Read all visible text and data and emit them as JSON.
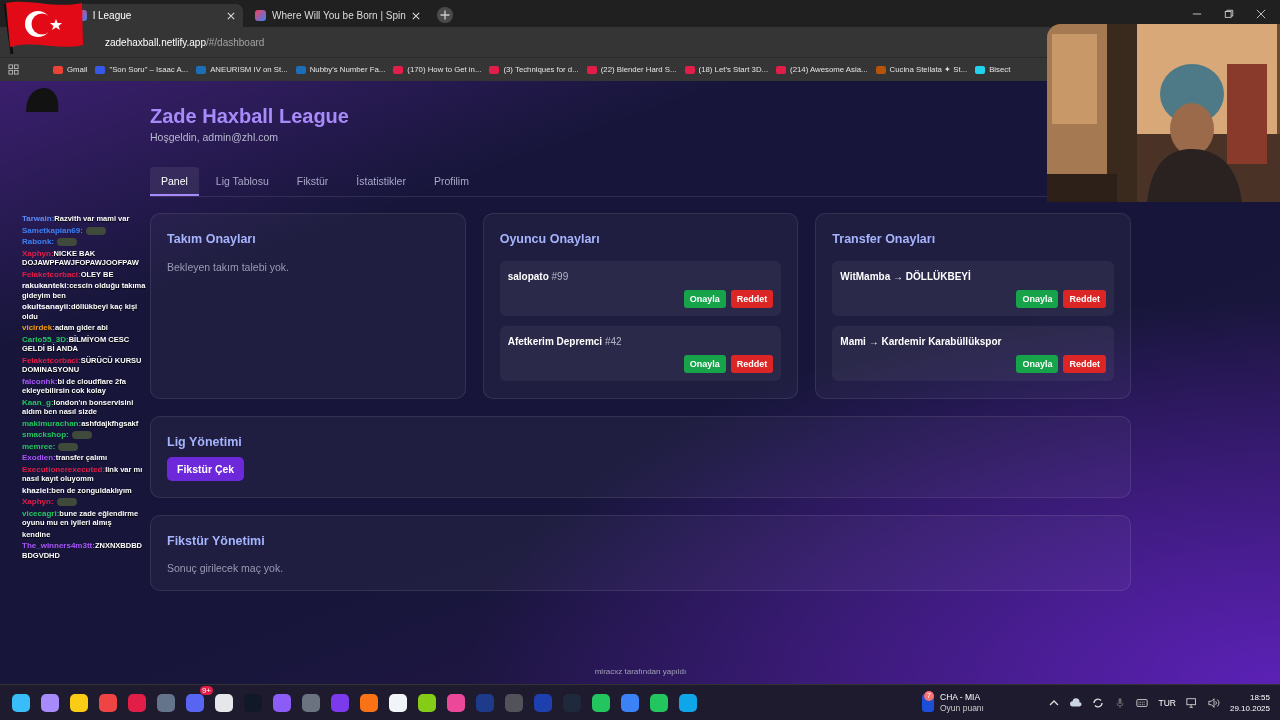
{
  "browser": {
    "tabs": [
      {
        "title": "l League",
        "selected": true
      },
      {
        "title": "Where Will You be Born | Spin",
        "selected": false
      }
    ],
    "url": {
      "host": "zadehaxball.netlify.app",
      "path": "/#/dashboard"
    },
    "bookmarks": [
      {
        "label": "Gmail",
        "kind": "mail"
      },
      {
        "label": "\"Son Soru\" – Isaac A...",
        "kind": "wp"
      },
      {
        "label": "ANEURISM IV on St...",
        "kind": "steam"
      },
      {
        "label": "Nubby's Number Fa...",
        "kind": "steam"
      },
      {
        "label": "(170) How to Get in...",
        "kind": "yt"
      },
      {
        "label": "(3) Techniques for d...",
        "kind": "yt"
      },
      {
        "label": "(22) Blender Hard S...",
        "kind": "yt"
      },
      {
        "label": "(18) Let's Start 3D...",
        "kind": "yt"
      },
      {
        "label": "(214) Awesome Asia...",
        "kind": "yt"
      },
      {
        "label": "Cucina Stellata ✦ St...",
        "kind": "page"
      },
      {
        "label": "Bisect",
        "kind": "cube"
      }
    ]
  },
  "app": {
    "title": "Zade Haxball League",
    "welcome": "Hoşgeldin, admin@zhl.com",
    "nav": [
      {
        "label": "Panel",
        "selected": true
      },
      {
        "label": "Lig Tablosu",
        "selected": false
      },
      {
        "label": "Fikstür",
        "selected": false
      },
      {
        "label": "İstatistikler",
        "selected": false
      },
      {
        "label": "Profilim",
        "selected": false
      }
    ],
    "team_approvals": {
      "title": "Takım Onayları",
      "empty": "Bekleyen takım talebi yok."
    },
    "player_approvals": {
      "title": "Oyuncu Onayları",
      "items": [
        {
          "name": "salopato",
          "number": "#99",
          "approve": "Onayla",
          "reject": "Reddet"
        },
        {
          "name": "Afetkerim Depremci",
          "number": "#42",
          "approve": "Onayla",
          "reject": "Reddet"
        }
      ]
    },
    "transfer_approvals": {
      "title": "Transfer Onayları",
      "items": [
        {
          "text": "WitMamba → DÖLLÜKBEYİ",
          "approve": "Onayla",
          "reject": "Reddet"
        },
        {
          "text": "Mami → Kardemir Karabüllükspor",
          "approve": "Onayla",
          "reject": "Reddet"
        }
      ]
    },
    "league_management": {
      "title": "Lig Yönetimi",
      "button": "Fikstür Çek"
    },
    "fixture_management": {
      "title": "Fikstür Yönetimi",
      "empty": "Sonuç girilecek maç yok."
    },
    "footer": "miracxz tarafından yapıldı"
  },
  "chat": [
    {
      "user": "Tarwain:",
      "color": "#5b8cff",
      "message": "Razvith var mami var"
    },
    {
      "user": "Sametkapian69:",
      "color": "#3b82f6",
      "emote": true
    },
    {
      "user": "Rabonk:",
      "color": "#3b82f6",
      "emote": true
    },
    {
      "user": "Xaphyn:",
      "color": "#e11d48",
      "message": "NICKE BAK DOJAWPFAWJFOPAWJOOFPAW"
    },
    {
      "user": "Felaketcorbaci:",
      "color": "#e11d48",
      "message": "OLEY BE"
    },
    {
      "user": "rakukanteki:",
      "color": "#ffffff",
      "message": "cescin olduğu takıma gideyim ben"
    },
    {
      "user": "okultsanayii:",
      "color": "#ffffff",
      "message": "döllükbeyi kaç kişi oldu"
    },
    {
      "user": "vicirdek:",
      "color": "#f59e0b",
      "message": "adam gider abi"
    },
    {
      "user": "Carlo55_3D:",
      "color": "#22c55e",
      "message": "BİLMİYOM CESC GELDİ Bİ ANDA"
    },
    {
      "user": "Felaketcorbaci:",
      "color": "#e11d48",
      "message": "SÜRÜCÜ KURSU DOMINASYONU"
    },
    {
      "user": "falconhk:",
      "color": "#a855f7",
      "message": "bi de cloudflare 2fa ekleyebilirsin cok kolay"
    },
    {
      "user": "Kaan_g:",
      "color": "#22c55e",
      "message": "london'ın bonservisini aldım ben nasıl sizde"
    },
    {
      "user": "makimurachan:",
      "color": "#22c55e",
      "message": "ashfdajkfhgsakf"
    },
    {
      "user": "smackshop:",
      "color": "#22c55e",
      "emote": true
    },
    {
      "user": "memree:",
      "color": "#22c55e",
      "emote": true
    },
    {
      "user": "Exodien:",
      "color": "#a855f7",
      "message": "transfer çalımı"
    },
    {
      "user": "Executionerexecuted:",
      "color": "#e11d48",
      "message": "link var mı nasıl kayıt oluyomm"
    },
    {
      "user": "khaziel:",
      "color": "#ffffff",
      "message": "ben de zonguldaklıyım"
    },
    {
      "user": "Xaphyn:",
      "color": "#e11d48",
      "emote": true
    },
    {
      "user": "vicecagri:",
      "color": "#22c55e",
      "message": "bune zade eğlendirme oyunu mu en iyileri almış"
    },
    {
      "message": "kendine"
    },
    {
      "user": "The_winners4m3tt:",
      "color": "#a855f7",
      "message": "ZNXNXBDBDBDGVDHD"
    }
  ],
  "taskbar": {
    "discord_badge": "9+",
    "widget": {
      "badge": "7",
      "title": "CHA - MIA",
      "subtitle": "Oyun puanı"
    },
    "language": "TUR",
    "time": "18:55",
    "date": "29.10.2025"
  }
}
